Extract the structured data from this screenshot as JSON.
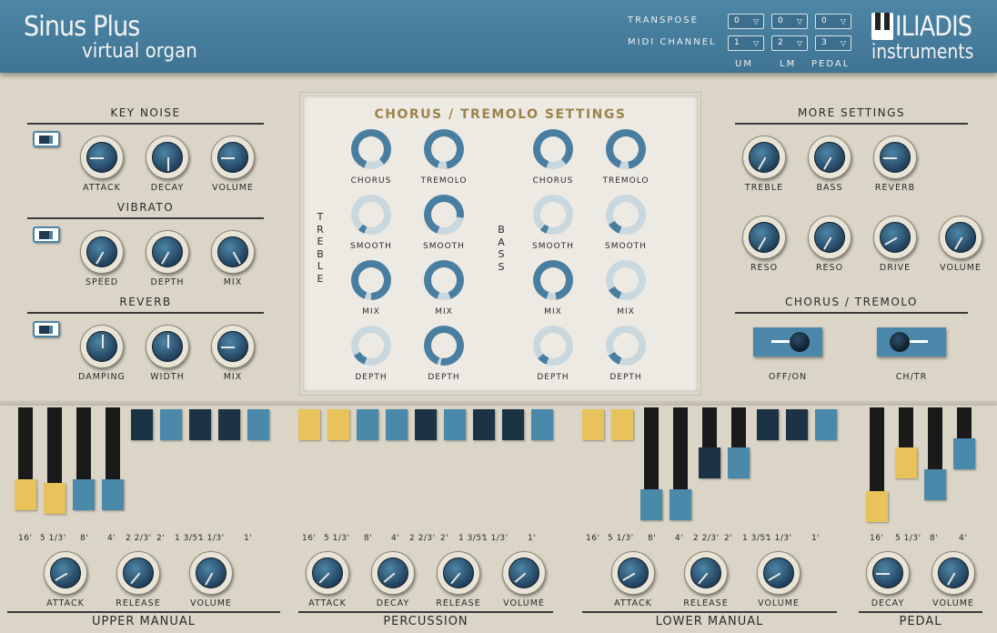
{
  "header": {
    "title": "Sinus Plus",
    "subtitle": "virtual organ",
    "transpose_label": "TRANSPOSE",
    "midi_label": "MIDI CHANNEL",
    "transpose": [
      "0",
      "0",
      "0"
    ],
    "midi": [
      "1",
      "2",
      "3"
    ],
    "columns": [
      "UM",
      "LM",
      "PEDAL"
    ],
    "logo_word": "ILIADIS",
    "logo_sub": "instruments"
  },
  "key_noise": {
    "title": "KEY NOISE",
    "knobs": [
      "ATTACK",
      "DECAY",
      "VOLUME"
    ]
  },
  "vibrato": {
    "title": "VIBRATO",
    "knobs": [
      "SPEED",
      "DEPTH",
      "MIX"
    ]
  },
  "reverb": {
    "title": "REVERB",
    "knobs": [
      "DAMPING",
      "WIDTH",
      "MIX"
    ]
  },
  "chorus_panel": {
    "title": "CHORUS / TREMOLO SETTINGS",
    "treble_vertical": "TREBLE",
    "bass_vertical": "BASS",
    "labels": [
      "CHORUS",
      "TREMOLO",
      "SMOOTH",
      "SMOOTH",
      "MIX",
      "MIX",
      "DEPTH",
      "DEPTH"
    ]
  },
  "more_settings": {
    "title": "MORE SETTINGS",
    "row1": [
      "TREBLE",
      "BASS",
      "REVERB"
    ],
    "row2": [
      "RESO",
      "RESO",
      "DRIVE",
      "VOLUME"
    ]
  },
  "chorus_tremolo": {
    "title": "CHORUS / TREMOLO",
    "switch1": "OFF/ON",
    "switch2": "CH/TR"
  },
  "drawbar_labels": [
    "16'",
    "5 1/3'",
    "8'",
    "4'",
    "2 2/3'",
    "2'",
    "1 3/5'",
    "1 1/3'",
    "1'"
  ],
  "pedal_labels": [
    "16'",
    "5 1/3'",
    "8'",
    "4'"
  ],
  "upper_manual": {
    "title": "UPPER MANUAL",
    "knobs": [
      "ATTACK",
      "RELEASE",
      "VOLUME"
    ]
  },
  "percussion": {
    "title": "PERCUSSION",
    "knobs": [
      "ATTACK",
      "DECAY",
      "RELEASE",
      "VOLUME"
    ]
  },
  "lower_manual": {
    "title": "LOWER MANUAL",
    "knobs": [
      "ATTACK",
      "RELEASE",
      "VOLUME"
    ]
  },
  "pedal": {
    "title": "PEDAL",
    "knobs": [
      "DECAY",
      "VOLUME"
    ]
  },
  "colors": {
    "accent_blue": "#4d86a6",
    "knob_dark": "#1e3c58",
    "drawbar_yellow": "#e8c25a",
    "drawbar_blue": "#4b89aa",
    "drawbar_dark": "#1b3344",
    "title_gold": "#9c834c"
  }
}
